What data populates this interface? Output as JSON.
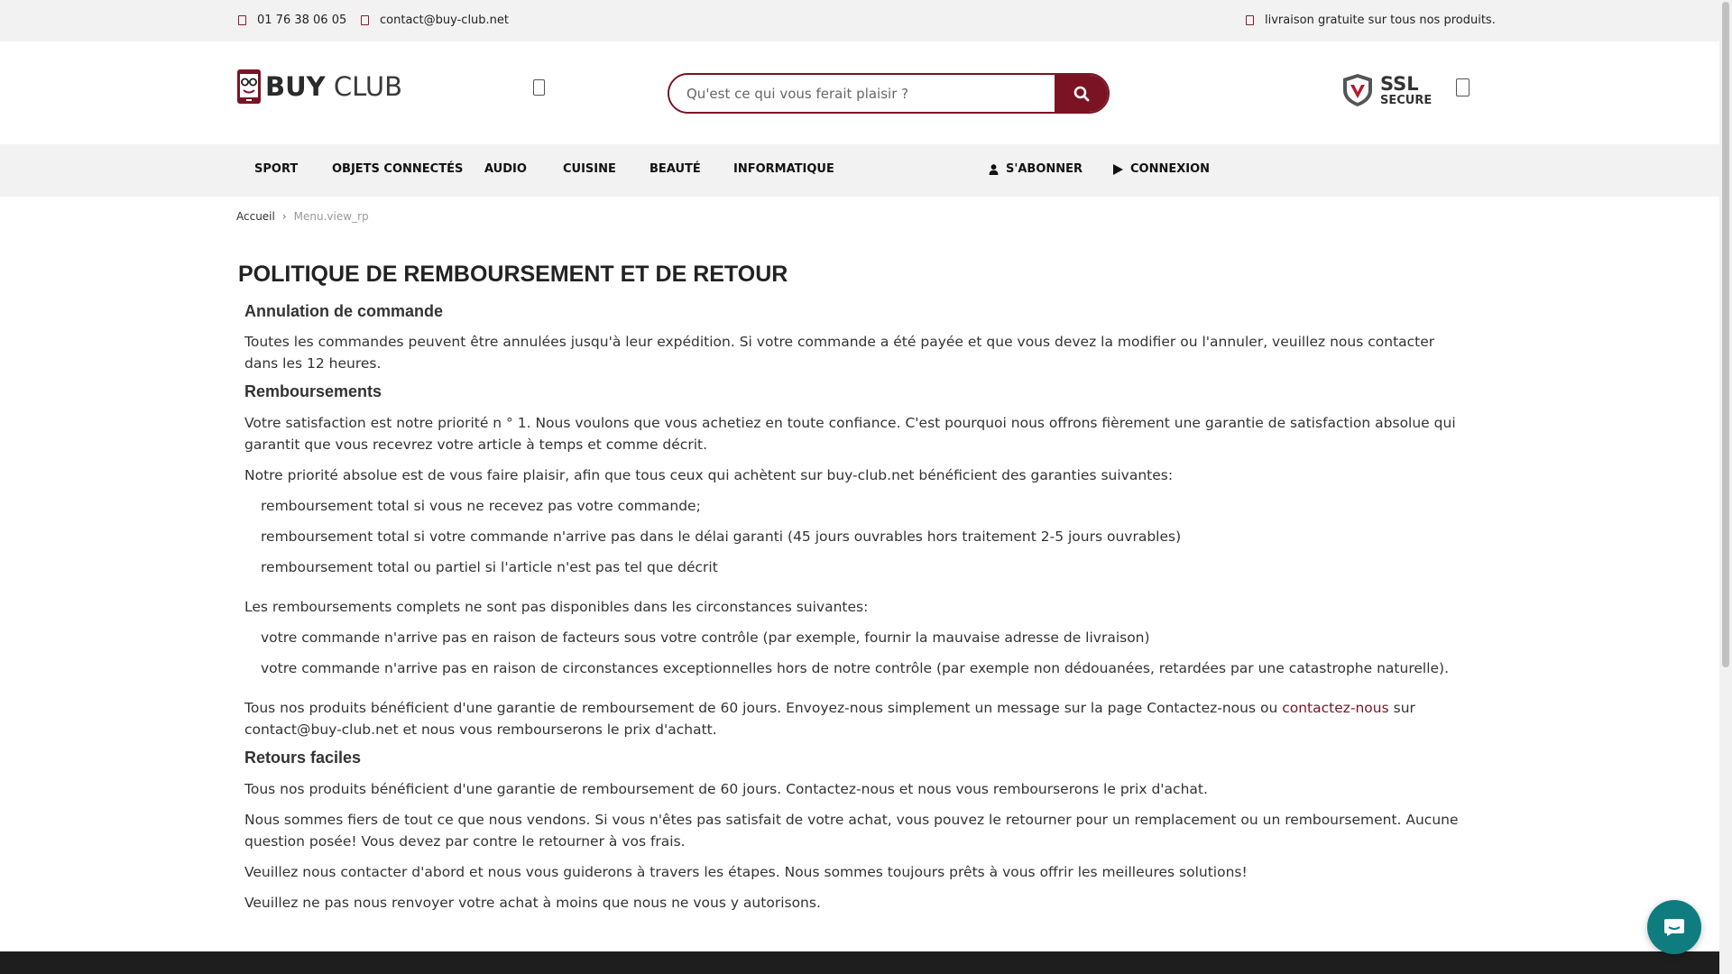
{
  "topbar": {
    "phone": "01 76 38 06 05",
    "email": "contact@buy-club.net",
    "shipping": "livraison gratuite sur tous nos produits."
  },
  "header": {
    "logo_buy": "BUY",
    "logo_club": "CLUB",
    "search_placeholder": "Qu'est ce qui vous ferait plaisir ?",
    "ssl_big": "SSL",
    "ssl_small": "SECURE"
  },
  "nav": {
    "items": [
      "SPORT",
      "OBJETS CONNECTÉS",
      "AUDIO",
      "CUISINE",
      "BEAUTÉ",
      "INFORMATIQUE"
    ],
    "subscribe": "S'ABONNER",
    "login": "CONNEXION"
  },
  "breadcrumb": {
    "home": "Accueil",
    "current": "Menu.view_rp"
  },
  "content": {
    "title": "POLITIQUE DE REMBOURSEMENT ET DE RETOUR",
    "s1_heading": "Annulation de commande",
    "s1_p1": "Toutes les commandes peuvent être annulées jusqu'à leur expédition. Si votre commande a été payée et que vous devez la modifier ou l'annuler, veuillez nous contacter dans les 12 heures.",
    "s2_heading": "Remboursements",
    "s2_p1": "Votre satisfaction est notre priorité n ° 1. Nous voulons que vous achetiez en toute confiance. C'est pourquoi nous offrons fièrement une garantie de satisfaction absolue qui garantit que vous recevrez votre article à temps et comme décrit.",
    "s2_p2": "Notre priorité absolue est de vous faire plaisir, afin que tous ceux qui achètent sur buy-club.net bénéficient des garanties suivantes:",
    "s2_list1": [
      "remboursement total si vous ne recevez pas votre commande;",
      "remboursement total si votre commande n'arrive pas dans le délai garanti (45 jours ouvrables hors traitement 2-5 jours ouvrables)",
      "remboursement total ou partiel si l'article n'est pas tel que décrit"
    ],
    "s2_p3": "Les remboursements complets ne sont pas disponibles dans les circonstances suivantes:",
    "s2_list2": [
      "votre commande n'arrive pas en raison de facteurs sous votre contrôle (par exemple, fournir la mauvaise adresse de livraison)",
      "votre commande n'arrive pas en raison de circonstances exceptionnelles hors de notre contrôle (par exemple non dédouanées, retardées par une catastrophe naturelle)."
    ],
    "s2_p4_a": "Tous nos produits bénéficient d'une garantie de remboursement de 60 jours. Envoyez-nous simplement un message sur la page Contactez-nous ou ",
    "s2_p4_link": "contactez-nous",
    "s2_p4_b": " sur contact@buy-club.net et nous vous rembourserons le prix d'achatt.",
    "s3_heading": "Retours faciles",
    "s3_p1": "Tous nos produits bénéficient d'une garantie de remboursement de 60 jours. Contactez-nous et nous vous rembourserons le prix d'achat.",
    "s3_p2": "Nous sommes fiers de tout ce que nous vendons. Si vous n'êtes pas satisfait de votre achat, vous pouvez le retourner pour un remplacement ou un remboursement. Aucune question posée! Vous devez par contre le retourner à vos frais.",
    "s3_p3": "Veuillez nous contacter d'abord et nous vous guiderons à travers les étapes. Nous sommes toujours prêts à vous offrir les meilleures solutions!",
    "s3_p4": "Veuillez ne pas nous renvoyer votre achat à moins que nous ne vous y autorisons."
  },
  "colors": {
    "brand": "#7a1424",
    "topbar_bg": "#f2f2f2",
    "chat": "#0f7c80",
    "footer": "#1e1e1e"
  },
  "icons": {
    "search": "search-icon",
    "user": "user-icon",
    "play": "play-icon",
    "chat": "chat-icon",
    "shield": "ssl-shield-icon"
  }
}
